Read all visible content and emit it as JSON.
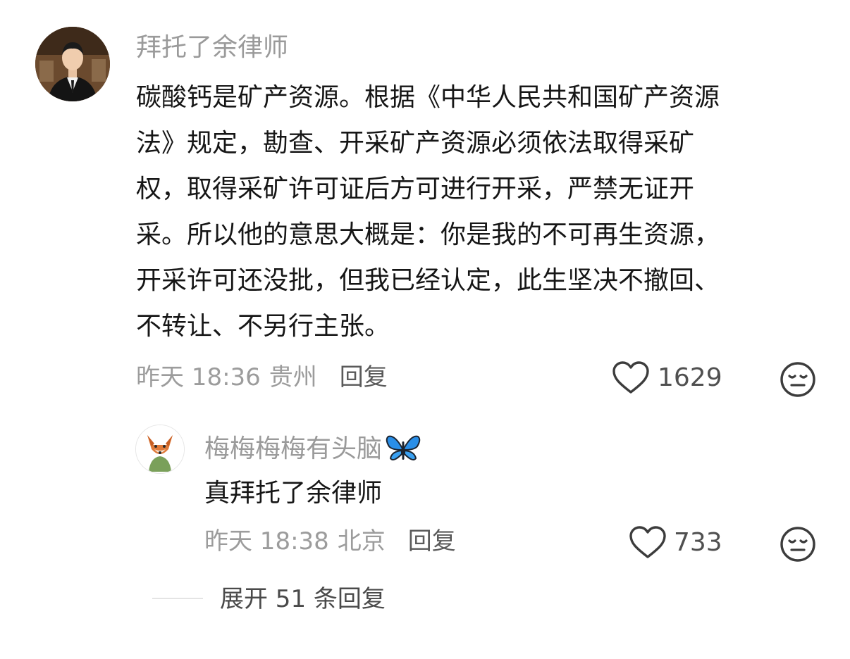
{
  "comment": {
    "username": "拜托了余律师",
    "body_lines": [
      "碳酸钙是矿产资源。根据《中华人民共和国矿产资源",
      "法》规定，勘查、开采矿产资源必须依法取得采矿",
      "权，取得采矿许可证后方可进行开采，严禁无证开",
      "采。所以他的意思大概是：你是我的不可再生资源，",
      "开采许可还没批，但我已经认定，此生坚决不撤回、",
      "不转让、不另行主张。"
    ],
    "time": "昨天 18:36",
    "location": "贵州",
    "reply_label": "回复",
    "like_count": "1629"
  },
  "reply": {
    "username": "梅梅梅梅有头脑",
    "username_emoji": "butterfly-icon",
    "body": "真拜托了余律师",
    "time": "昨天 18:38",
    "location": "北京",
    "reply_label": "回复",
    "like_count": "733"
  },
  "expand": {
    "label": "展开 51 条回复"
  },
  "colors": {
    "meta_gray": "#9c9c9c",
    "butterfly_blue": "#2a8fe8"
  }
}
